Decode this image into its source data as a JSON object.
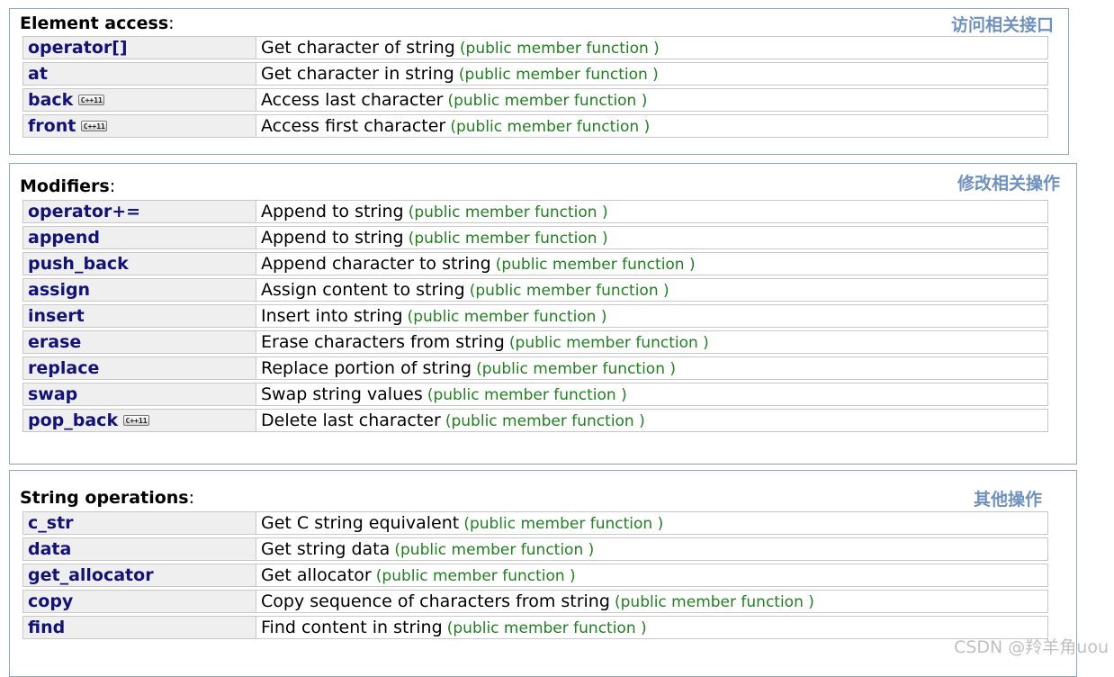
{
  "sections": [
    {
      "title": "Element access",
      "colon": ":",
      "note": "访问相关接口",
      "rows": [
        {
          "name": "operator[]",
          "desc": "Get character of string",
          "kind": "(public member function )",
          "cpp11": false
        },
        {
          "name": "at",
          "desc": "Get character in string",
          "kind": "(public member function )",
          "cpp11": false
        },
        {
          "name": "back",
          "desc": "Access last character",
          "kind": "(public member function )",
          "cpp11": true
        },
        {
          "name": "front",
          "desc": "Access first character",
          "kind": "(public member function )",
          "cpp11": true
        }
      ]
    },
    {
      "title": "Modifiers",
      "colon": ":",
      "note": "修改相关操作",
      "rows": [
        {
          "name": "operator+=",
          "desc": "Append to string",
          "kind": "(public member function )",
          "cpp11": false
        },
        {
          "name": "append",
          "desc": "Append to string",
          "kind": "(public member function )",
          "cpp11": false
        },
        {
          "name": "push_back",
          "desc": "Append character to string",
          "kind": "(public member function )",
          "cpp11": false
        },
        {
          "name": "assign",
          "desc": "Assign content to string",
          "kind": "(public member function )",
          "cpp11": false
        },
        {
          "name": "insert",
          "desc": "Insert into string",
          "kind": "(public member function )",
          "cpp11": false
        },
        {
          "name": "erase",
          "desc": "Erase characters from string",
          "kind": "(public member function )",
          "cpp11": false
        },
        {
          "name": "replace",
          "desc": "Replace portion of string",
          "kind": "(public member function )",
          "cpp11": false
        },
        {
          "name": "swap",
          "desc": "Swap string values",
          "kind": "(public member function )",
          "cpp11": false
        },
        {
          "name": "pop_back",
          "desc": "Delete last character",
          "kind": "(public member function )",
          "cpp11": true
        }
      ]
    },
    {
      "title": "String operations",
      "colon": ":",
      "note": "其他操作",
      "rows": [
        {
          "name": "c_str",
          "desc": "Get C string equivalent",
          "kind": "(public member function )",
          "cpp11": false
        },
        {
          "name": "data",
          "desc": "Get string data",
          "kind": "(public member function )",
          "cpp11": false
        },
        {
          "name": "get_allocator",
          "desc": "Get allocator",
          "kind": "(public member function )",
          "cpp11": false
        },
        {
          "name": "copy",
          "desc": "Copy sequence of characters from string",
          "kind": "(public member function )",
          "cpp11": false
        },
        {
          "name": "find",
          "desc": "Find content in string",
          "kind": "(public member function )",
          "cpp11": false
        }
      ]
    }
  ],
  "badge_label": "C++11",
  "watermark": "CSDN @羚羊角uou"
}
